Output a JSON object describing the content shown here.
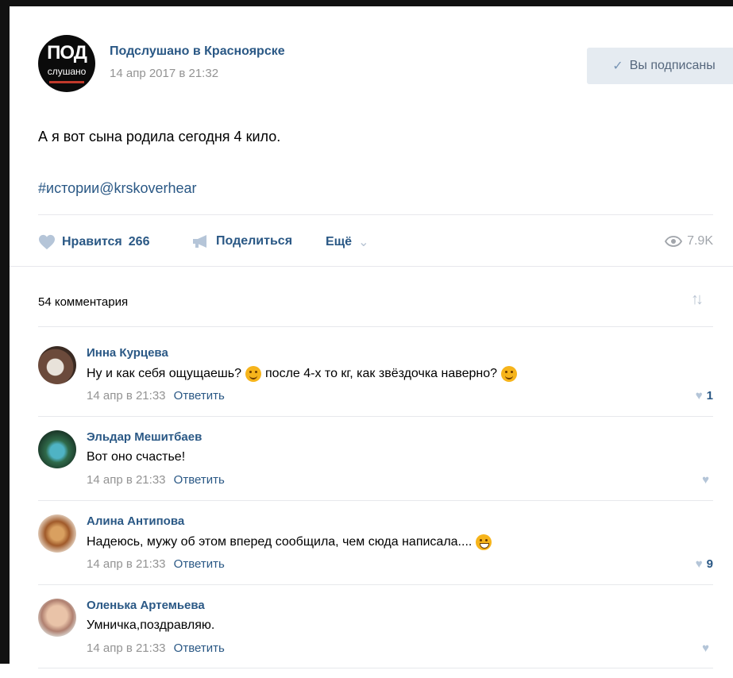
{
  "post": {
    "group_name": "Подслушано в Красноярске",
    "avatar_big": "ПОД",
    "avatar_small": "слушано",
    "date": "14 апр 2017 в 21:32",
    "subscribed_label": "Вы подписаны",
    "text": "А я вот сына родила сегодня 4 кило.",
    "hashtag": "#истории@krskoverhear"
  },
  "actions": {
    "like_label": "Нравится",
    "like_count": "266",
    "share_label": "Поделиться",
    "more_label": "Ещё",
    "views": "7.9K"
  },
  "comments_header": {
    "count_label": "54 комментария"
  },
  "comments": [
    {
      "name": "Инна Курцева",
      "text_parts": [
        "Ну и как себя ощущаешь?",
        "после 4-х то кг, как звёздочка наверно?"
      ],
      "date": "14 апр в 21:33",
      "reply_label": "Ответить",
      "likes": "1"
    },
    {
      "name": "Эльдар Мешитбаев",
      "text_parts": [
        "Вот оно счастье!"
      ],
      "date": "14 апр в 21:33",
      "reply_label": "Ответить",
      "likes": ""
    },
    {
      "name": "Алина Антипова",
      "text_parts": [
        "Надеюсь, мужу об этом вперед сообщила, чем сюда написала...."
      ],
      "date": "14 апр в 21:33",
      "reply_label": "Ответить",
      "likes": "9"
    },
    {
      "name": "Оленька Артемьева",
      "text_parts": [
        "Умничка,поздравляю."
      ],
      "date": "14 апр в 21:33",
      "reply_label": "Ответить",
      "likes": ""
    }
  ],
  "colors": {
    "link": "#2a5885",
    "muted": "#939393",
    "divider": "#e7e8ec",
    "button_bg": "#e5ebf1"
  }
}
